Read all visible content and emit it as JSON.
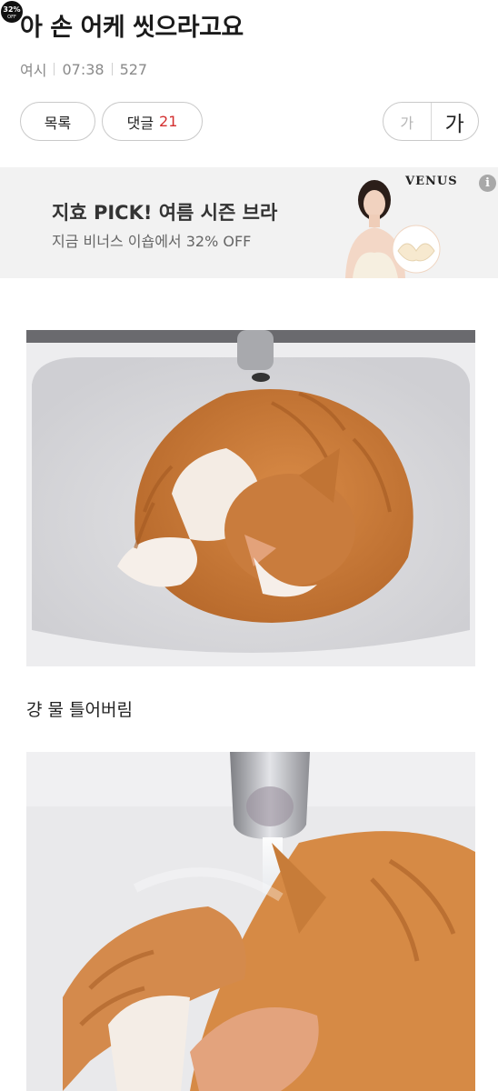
{
  "post": {
    "title": "아 손 어케 씻으라고요",
    "author": "여시",
    "time": "07:38",
    "views": "527"
  },
  "actions": {
    "list_label": "목록",
    "comments_label": "댓글",
    "comments_count": "21",
    "font_small_label": "가",
    "font_large_label": "가"
  },
  "ad": {
    "headline": "지효 PICK! 여름 시즌 브라",
    "subtext": "지금 비너스 이숍에서 32% OFF",
    "brand": "VENUS",
    "badge_percent": "32%",
    "badge_off": "OFF",
    "info_icon": "i"
  },
  "content": {
    "caption": "걍 물 틀어버림",
    "images": [
      {
        "subject": "orange-white-cat-curled-in-sink"
      },
      {
        "subject": "cat-under-running-faucet"
      }
    ]
  },
  "colors": {
    "accent_red": "#d32f2f",
    "meta_gray": "#8a8a8a",
    "ad_bg": "#f2f2f2"
  }
}
